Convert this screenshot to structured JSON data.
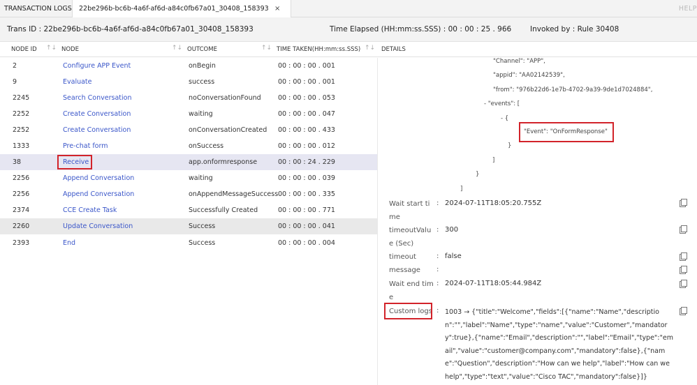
{
  "tabs": {
    "transaction_logs": "TRANSACTION LOGS",
    "active_tab": "22be296b-bc6b-4a6f-af6d-a84c0fb67a01_30408_158393",
    "close_icon": "×",
    "help": "HELP"
  },
  "info": {
    "trans_id": "Trans ID : 22be296b-bc6b-4a6f-af6d-a84c0fb67a01_30408_158393",
    "time_elapsed": "Time Elapsed (HH:mm:ss.SSS) :  00 : 00 : 25 . 966",
    "invoked_by": "Invoked by : Rule 30408"
  },
  "columns": {
    "node_id": "NODE ID",
    "node": "NODE",
    "outcome": "OUTCOME",
    "time_taken": "TIME TAKEN(HH:mm:ss.SSS)",
    "details": "DETAILS",
    "sort_icon": "↑↓"
  },
  "rows": [
    {
      "id": "2",
      "node": "Configure APP Event",
      "outcome": "onBegin",
      "time": "00 : 00 : 00 . 001"
    },
    {
      "id": "9",
      "node": "Evaluate",
      "outcome": "success",
      "time": "00 : 00 : 00 . 001"
    },
    {
      "id": "2245",
      "node": "Search Conversation",
      "outcome": "noConversationFound",
      "time": "00 : 00 : 00 . 053"
    },
    {
      "id": "2252",
      "node": "Create Conversation",
      "outcome": "waiting",
      "time": "00 : 00 : 00 . 047"
    },
    {
      "id": "2252",
      "node": "Create Conversation",
      "outcome": "onConversationCreated",
      "time": "00 : 00 : 00 . 433"
    },
    {
      "id": "1333",
      "node": "Pre-chat form",
      "outcome": "onSuccess",
      "time": "00 : 00 : 00 . 012"
    },
    {
      "id": "38",
      "node": "Receive",
      "outcome": "app.onformresponse",
      "time": "00 : 00 : 24 . 229"
    },
    {
      "id": "2256",
      "node": "Append Conversation",
      "outcome": "waiting",
      "time": "00 : 00 : 00 . 039"
    },
    {
      "id": "2256",
      "node": "Append Conversation",
      "outcome": "onAppendMessageSuccess",
      "time": "00 : 00 : 00 . 335"
    },
    {
      "id": "2374",
      "node": "CCE Create Task",
      "outcome": "Successfully Created",
      "time": "00 : 00 : 00 . 771"
    },
    {
      "id": "2260",
      "node": "Update Conversation",
      "outcome": "Success",
      "time": "00 : 00 : 00 . 041"
    },
    {
      "id": "2393",
      "node": "End",
      "outcome": "Success",
      "time": "00 : 00 : 00 . 004"
    }
  ],
  "json": {
    "channel": "\"Channel\": \"APP\",",
    "appid": "\"appid\": \"AA02142539\",",
    "from": "\"from\": \"976b22d6-1e7b-4702-9a39-9de1d7024884\",",
    "events": "-  \"events\": [",
    "obj_open": "-  {",
    "event": "\"Event\": \"OnFormResponse\"",
    "obj_close": "}",
    "arr_close": "]",
    "outer_close": "}",
    "final_close": "]"
  },
  "kv": {
    "wait_start_label": "Wait start time",
    "wait_start_value": "2024-07-11T18:05:20.755Z",
    "timeout_value_label": "timeoutValue (Sec)",
    "timeout_value_value": "300",
    "timeout_label": "timeout",
    "timeout_value": "false",
    "message_label": "message",
    "wait_end_label": "Wait end time",
    "wait_end_value": "2024-07-11T18:05:44.984Z",
    "custom_logs_label": "Custom logs",
    "custom_logs_value": "1003 → {\"title\":\"Welcome\",\"fields\":[{\"name\":\"Name\",\"description\":\"\",\"label\":\"Name\",\"type\":\"name\",\"value\":\"Customer\",\"mandatory\":true},{\"name\":\"Email\",\"description\":\"\",\"label\":\"Email\",\"type\":\"email\",\"value\":\"customer@company.com\",\"mandatory\":false},{\"name\":\"Question\",\"description\":\"How can we help\",\"label\":\"How can we help\",\"type\":\"text\",\"value\":\"Cisco TAC\",\"mandatory\":false}]}",
    "colon": ":"
  },
  "colors": {
    "link": "#3a56c9",
    "highlight": "#d2232a",
    "selected_row": "#e6e6f2"
  }
}
